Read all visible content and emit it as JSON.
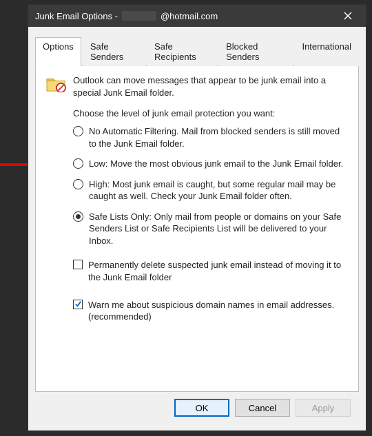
{
  "window": {
    "title_prefix": "Junk Email Options -",
    "account_suffix": "@hotmail.com"
  },
  "tabs": {
    "options": "Options",
    "safe_senders": "Safe Senders",
    "safe_recipients": "Safe Recipients",
    "blocked_senders": "Blocked Senders",
    "international": "International"
  },
  "content": {
    "intro": "Outlook can move messages that appear to be junk email into a special Junk Email folder.",
    "choose_label": "Choose the level of junk email protection you want:"
  },
  "radios": {
    "no_auto": "No Automatic Filtering. Mail from blocked senders is still moved to the Junk Email folder.",
    "low": "Low: Move the most obvious junk email to the Junk Email folder.",
    "high": "High: Most junk email is caught, but some regular mail may be caught as well. Check your Junk Email folder often.",
    "safe_lists": "Safe Lists Only: Only mail from people or domains on your Safe Senders List or Safe Recipients List will be delivered to your Inbox."
  },
  "checks": {
    "perm_delete": "Permanently delete suspected junk email instead of moving it to the Junk Email folder",
    "warn_domain": "Warn me about suspicious domain names in email addresses. (recommended)"
  },
  "buttons": {
    "ok": "OK",
    "cancel": "Cancel",
    "apply": "Apply"
  }
}
